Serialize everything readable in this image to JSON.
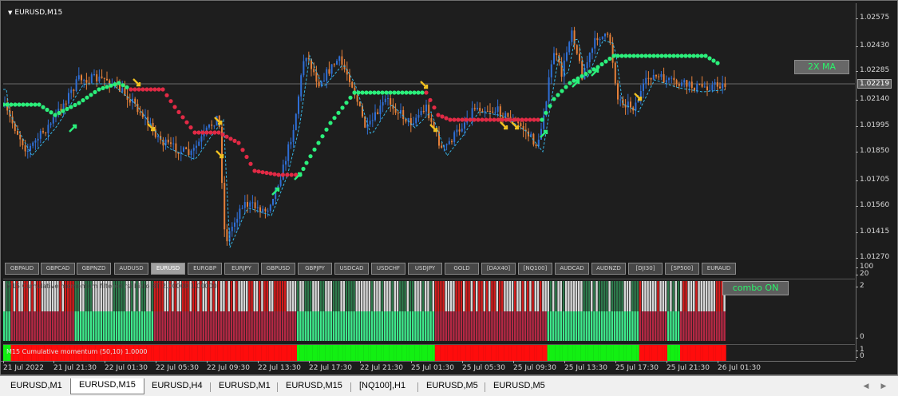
{
  "window": {
    "symbol_title": "EURUSD,M15"
  },
  "price_axis": {
    "ticks": [
      "1.02575",
      "1.02430",
      "1.02285",
      "1.02140",
      "1.01995",
      "1.01850",
      "1.01705",
      "1.01560",
      "1.01415",
      "1.01270"
    ],
    "current_price": "1.02219",
    "indicator1_ticks": [
      "2",
      "0"
    ],
    "indicator2_ticks": [
      "1",
      "0"
    ],
    "scale_top": "100",
    "scale_mid": "20"
  },
  "time_axis": {
    "labels": [
      "21 Jul 2022",
      "21 Jul 21:30",
      "22 Jul 01:30",
      "22 Jul 05:30",
      "22 Jul 09:30",
      "22 Jul 13:30",
      "22 Jul 17:30",
      "22 Jul 21:30",
      "25 Jul 01:30",
      "25 Jul 05:30",
      "25 Jul 09:30",
      "25 Jul 13:30",
      "25 Jul 17:30",
      "25 Jul 21:30",
      "26 Jul 01:30"
    ]
  },
  "buttons": {
    "ma_label": "2X MA",
    "combo_label": "combo ON"
  },
  "symbol_buttons": [
    "GBPAUD",
    "GBPCAD",
    "GBPNZD",
    "AUDUSD",
    "EURUSD",
    "EURGBP",
    "EURJPY",
    "GBPUSD",
    "GBPJPY",
    "USDCAD",
    "USDCHF",
    "USDJPY",
    "GOLD",
    "[DAX40]",
    "[NQ100]",
    "AUDCAD",
    "AUDNZD",
    "[DJI30]",
    "[SP500]",
    "EURAUD"
  ],
  "active_symbol": "EURUSD",
  "indicators": {
    "label1": "M15 Cumulative momentum filtered rsi histo BT 2.00000 1.00000",
    "label2": "M15 Cumulative momentum (50,10) 1.0000"
  },
  "tabs": [
    "EURUSD,M1",
    "EURUSD,M15",
    "EURUSD,H4",
    "EURUSD,M1",
    "EURUSD,M15",
    "[NQ100],H1",
    "EURUSD,M5",
    "EURUSD,M5"
  ],
  "active_tab_index": 1,
  "colors": {
    "background": "#1e1e1e",
    "bull_candle": "#2f6fd6",
    "bear_candle": "#e5803a",
    "trend_up": "#2bef7b",
    "trend_down": "#e12a45",
    "arrow_signal": "#f0c020",
    "histo_grey": "#d6d6d6",
    "histo_darkgreen": "#2e7a4c",
    "histo_red": "#d41c1c",
    "histo_lightgreen": "#3ee88b",
    "histo_crimson": "#b52844",
    "momentum_green": "#12f012",
    "momentum_red": "#ff0c0c"
  }
}
